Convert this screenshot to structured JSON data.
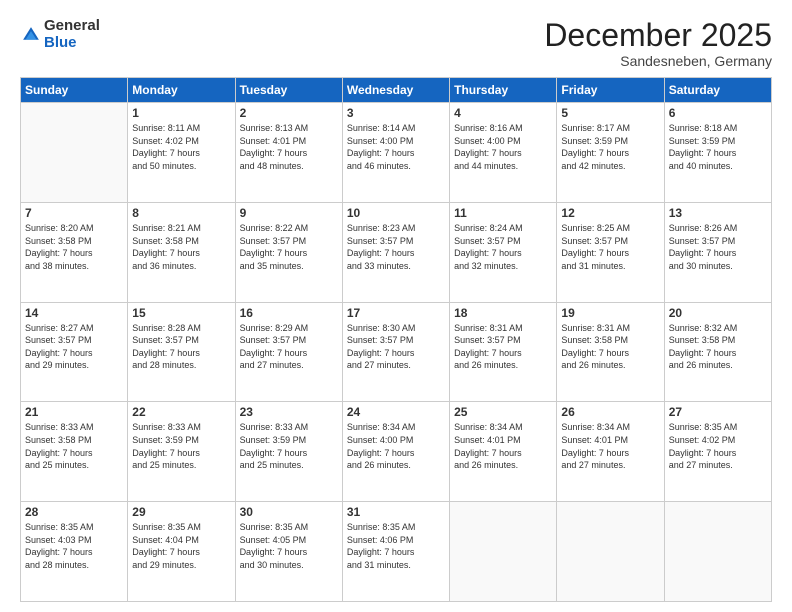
{
  "header": {
    "logo_general": "General",
    "logo_blue": "Blue",
    "month_title": "December 2025",
    "subtitle": "Sandesneben, Germany"
  },
  "days_of_week": [
    "Sunday",
    "Monday",
    "Tuesday",
    "Wednesday",
    "Thursday",
    "Friday",
    "Saturday"
  ],
  "weeks": [
    [
      {
        "day": "",
        "info": ""
      },
      {
        "day": "1",
        "info": "Sunrise: 8:11 AM\nSunset: 4:02 PM\nDaylight: 7 hours\nand 50 minutes."
      },
      {
        "day": "2",
        "info": "Sunrise: 8:13 AM\nSunset: 4:01 PM\nDaylight: 7 hours\nand 48 minutes."
      },
      {
        "day": "3",
        "info": "Sunrise: 8:14 AM\nSunset: 4:00 PM\nDaylight: 7 hours\nand 46 minutes."
      },
      {
        "day": "4",
        "info": "Sunrise: 8:16 AM\nSunset: 4:00 PM\nDaylight: 7 hours\nand 44 minutes."
      },
      {
        "day": "5",
        "info": "Sunrise: 8:17 AM\nSunset: 3:59 PM\nDaylight: 7 hours\nand 42 minutes."
      },
      {
        "day": "6",
        "info": "Sunrise: 8:18 AM\nSunset: 3:59 PM\nDaylight: 7 hours\nand 40 minutes."
      }
    ],
    [
      {
        "day": "7",
        "info": "Sunrise: 8:20 AM\nSunset: 3:58 PM\nDaylight: 7 hours\nand 38 minutes."
      },
      {
        "day": "8",
        "info": "Sunrise: 8:21 AM\nSunset: 3:58 PM\nDaylight: 7 hours\nand 36 minutes."
      },
      {
        "day": "9",
        "info": "Sunrise: 8:22 AM\nSunset: 3:57 PM\nDaylight: 7 hours\nand 35 minutes."
      },
      {
        "day": "10",
        "info": "Sunrise: 8:23 AM\nSunset: 3:57 PM\nDaylight: 7 hours\nand 33 minutes."
      },
      {
        "day": "11",
        "info": "Sunrise: 8:24 AM\nSunset: 3:57 PM\nDaylight: 7 hours\nand 32 minutes."
      },
      {
        "day": "12",
        "info": "Sunrise: 8:25 AM\nSunset: 3:57 PM\nDaylight: 7 hours\nand 31 minutes."
      },
      {
        "day": "13",
        "info": "Sunrise: 8:26 AM\nSunset: 3:57 PM\nDaylight: 7 hours\nand 30 minutes."
      }
    ],
    [
      {
        "day": "14",
        "info": "Sunrise: 8:27 AM\nSunset: 3:57 PM\nDaylight: 7 hours\nand 29 minutes."
      },
      {
        "day": "15",
        "info": "Sunrise: 8:28 AM\nSunset: 3:57 PM\nDaylight: 7 hours\nand 28 minutes."
      },
      {
        "day": "16",
        "info": "Sunrise: 8:29 AM\nSunset: 3:57 PM\nDaylight: 7 hours\nand 27 minutes."
      },
      {
        "day": "17",
        "info": "Sunrise: 8:30 AM\nSunset: 3:57 PM\nDaylight: 7 hours\nand 27 minutes."
      },
      {
        "day": "18",
        "info": "Sunrise: 8:31 AM\nSunset: 3:57 PM\nDaylight: 7 hours\nand 26 minutes."
      },
      {
        "day": "19",
        "info": "Sunrise: 8:31 AM\nSunset: 3:58 PM\nDaylight: 7 hours\nand 26 minutes."
      },
      {
        "day": "20",
        "info": "Sunrise: 8:32 AM\nSunset: 3:58 PM\nDaylight: 7 hours\nand 26 minutes."
      }
    ],
    [
      {
        "day": "21",
        "info": "Sunrise: 8:33 AM\nSunset: 3:58 PM\nDaylight: 7 hours\nand 25 minutes."
      },
      {
        "day": "22",
        "info": "Sunrise: 8:33 AM\nSunset: 3:59 PM\nDaylight: 7 hours\nand 25 minutes."
      },
      {
        "day": "23",
        "info": "Sunrise: 8:33 AM\nSunset: 3:59 PM\nDaylight: 7 hours\nand 25 minutes."
      },
      {
        "day": "24",
        "info": "Sunrise: 8:34 AM\nSunset: 4:00 PM\nDaylight: 7 hours\nand 26 minutes."
      },
      {
        "day": "25",
        "info": "Sunrise: 8:34 AM\nSunset: 4:01 PM\nDaylight: 7 hours\nand 26 minutes."
      },
      {
        "day": "26",
        "info": "Sunrise: 8:34 AM\nSunset: 4:01 PM\nDaylight: 7 hours\nand 27 minutes."
      },
      {
        "day": "27",
        "info": "Sunrise: 8:35 AM\nSunset: 4:02 PM\nDaylight: 7 hours\nand 27 minutes."
      }
    ],
    [
      {
        "day": "28",
        "info": "Sunrise: 8:35 AM\nSunset: 4:03 PM\nDaylight: 7 hours\nand 28 minutes."
      },
      {
        "day": "29",
        "info": "Sunrise: 8:35 AM\nSunset: 4:04 PM\nDaylight: 7 hours\nand 29 minutes."
      },
      {
        "day": "30",
        "info": "Sunrise: 8:35 AM\nSunset: 4:05 PM\nDaylight: 7 hours\nand 30 minutes."
      },
      {
        "day": "31",
        "info": "Sunrise: 8:35 AM\nSunset: 4:06 PM\nDaylight: 7 hours\nand 31 minutes."
      },
      {
        "day": "",
        "info": ""
      },
      {
        "day": "",
        "info": ""
      },
      {
        "day": "",
        "info": ""
      }
    ]
  ]
}
